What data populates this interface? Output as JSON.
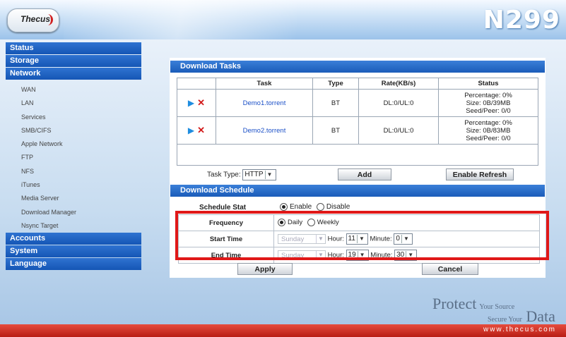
{
  "header": {
    "logo": "Thecus",
    "model": "N299"
  },
  "sidebar": {
    "categories": [
      {
        "label": "Status"
      },
      {
        "label": "Storage"
      },
      {
        "label": "Network"
      }
    ],
    "network_items": [
      "WAN",
      "LAN",
      "Services",
      "SMB/CIFS",
      "Apple Network",
      "FTP",
      "NFS",
      "iTunes",
      "Media Server",
      "Download Manager",
      "Nsync Target"
    ],
    "bottom_categories": [
      "Accounts",
      "System",
      "Language"
    ]
  },
  "download_tasks": {
    "title": "Download Tasks",
    "columns": [
      "Task",
      "Type",
      "Rate(KB/s)",
      "Status"
    ],
    "rows": [
      {
        "task": "Demo1.torrent",
        "type": "BT",
        "rate": "DL:0/UL:0",
        "status": [
          "Percentage: 0%",
          "Size: 0B/39MB",
          "Seed/Peer: 0/0"
        ]
      },
      {
        "task": "Demo2.torrent",
        "type": "BT",
        "rate": "DL:0/UL:0",
        "status": [
          "Percentage: 0%",
          "Size: 0B/83MB",
          "Seed/Peer: 0/0"
        ]
      }
    ],
    "task_type_label": "Task Type:",
    "task_type_value": "HTTP",
    "add_label": "Add",
    "refresh_label": "Enable Refresh"
  },
  "schedule": {
    "title": "Download Schedule",
    "stat_label": "Schedule Stat",
    "enable": "Enable",
    "disable": "Disable",
    "frequency_label": "Frequency",
    "daily": "Daily",
    "weekly": "Weekly",
    "start_label": "Start Time",
    "end_label": "End Time",
    "day_value": "Sunday",
    "hour_label": "Hour:",
    "minute_label": "Minute:",
    "start_hour": "11",
    "start_minute": "0",
    "end_hour": "19",
    "end_minute": "30",
    "apply_label": "Apply",
    "cancel_label": "Cancel"
  },
  "brand": {
    "protect": "Protect",
    "your_source": "Your Source",
    "secure_your": "Secure Your",
    "data": "Data"
  },
  "footer": {
    "url": "www.thecus.com"
  },
  "colors": {
    "accent": "#1a5cb9",
    "highlight": "#e01818",
    "footer": "#c0241a"
  }
}
